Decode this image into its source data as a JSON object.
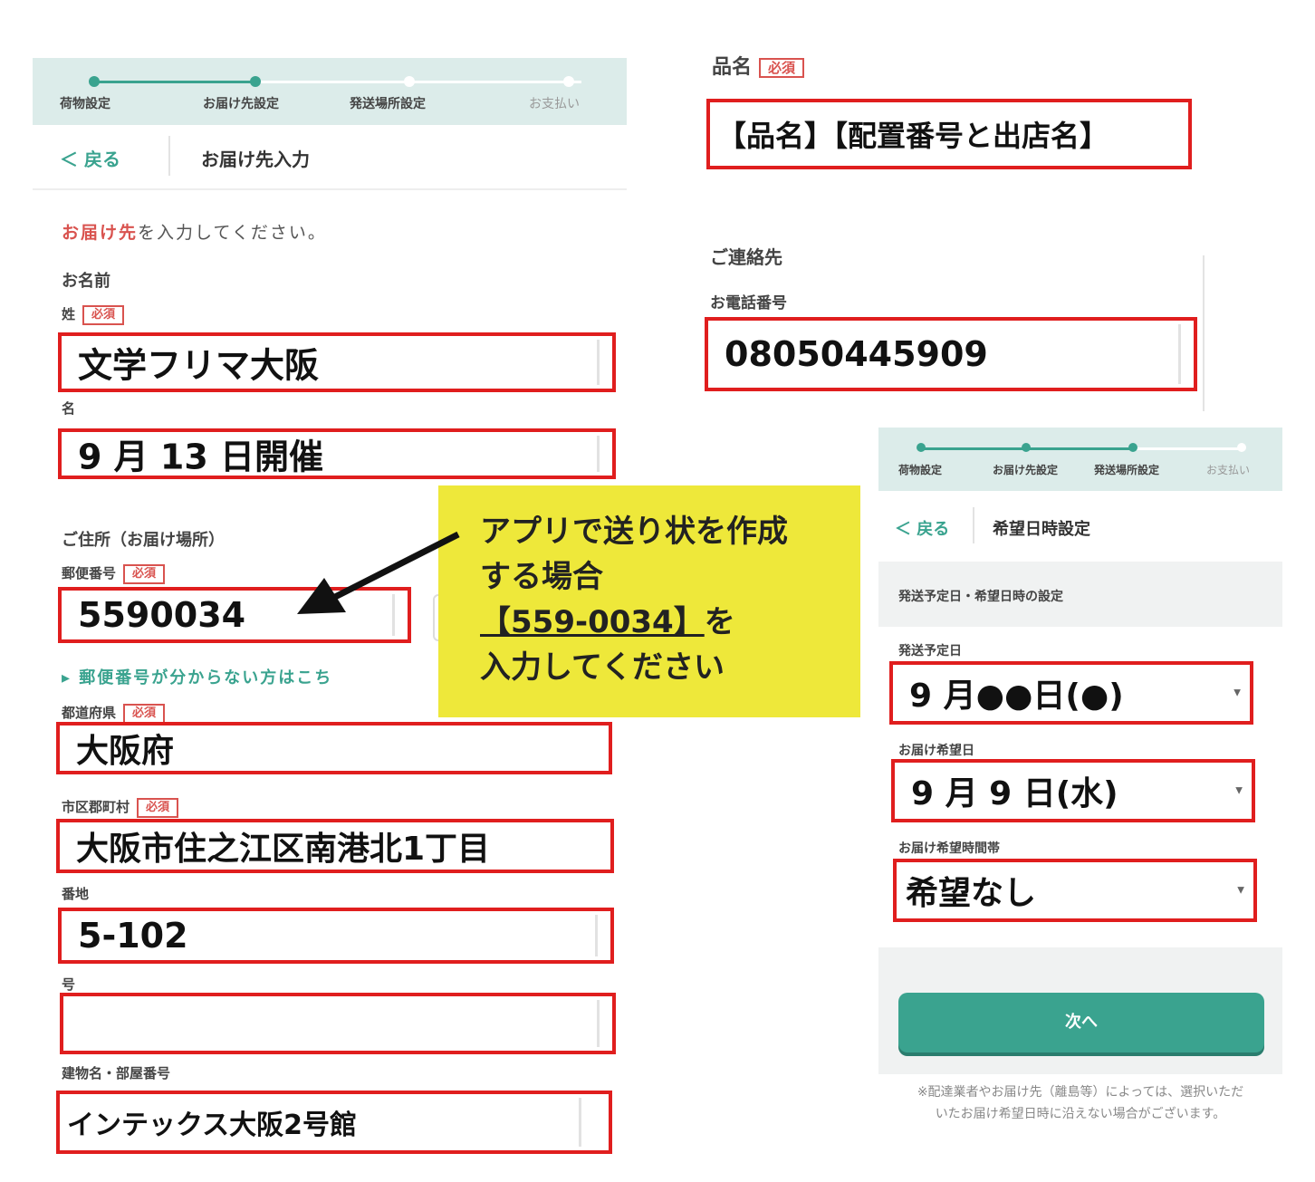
{
  "left_form": {
    "stepper": [
      "荷物設定",
      "お届け先設定",
      "発送場所設定",
      "お支払い"
    ],
    "back_label": "＜ 戻る",
    "header_title": "お届け先入力",
    "prompt_highlight": "お届け先",
    "prompt_rest": "を入力してください。",
    "name_section": "お名前",
    "last_name_label": "姓",
    "required_badge": "必須",
    "last_name_value": "文学フリマ大阪",
    "first_name_label": "名",
    "first_name_value": "9 月 13 日開催",
    "address_section": "ご住所（お届け場所）",
    "postal_label": "郵便番号",
    "postal_value": "5590034",
    "postal_help": "▸ 郵便番号が分からない方はこち",
    "prefecture_label": "都道府県",
    "prefecture_value": "大阪府",
    "city_label": "市区郡町村",
    "city_value": "大阪市住之江区南港北1丁目",
    "banchi_label": "番地",
    "banchi_value": "5-102",
    "go_label": "号",
    "go_value": "",
    "building_label": "建物名・部屋番号",
    "building_value": "インテックス大阪2号館"
  },
  "item_contact": {
    "item_label": "品名",
    "required_badge": "必須",
    "item_value": "【品名】【配置番号と出店名】",
    "contact_section": "ご連絡先",
    "phone_label": "お電話番号",
    "phone_value": "08050445909"
  },
  "callout": {
    "line1": "アプリで送り状を作成",
    "line2": "する場合",
    "line3_underlined": "【559-0034】",
    "line3_rest": "を",
    "line4": "入力してください"
  },
  "schedule_form": {
    "stepper": [
      "荷物設定",
      "お届け先設定",
      "発送場所設定",
      "お支払い"
    ],
    "back_label": "＜ 戻る",
    "header_title": "希望日時設定",
    "section_title": "発送予定日・希望日時の設定",
    "ship_date_label": "発送予定日",
    "ship_date_value": "9 月●●日(●)",
    "delivery_date_label": "お届け希望日",
    "delivery_date_value": "9 月 9 日(水)",
    "delivery_time_label": "お届け希望時間帯",
    "delivery_time_value": "希望なし",
    "next_button": "次へ",
    "footnote_line1": "※配達業者やお届け先（離島等）によっては、選択いただ",
    "footnote_line2": "いたお届け希望日時に沿えない場合がございます。"
  },
  "colors": {
    "accent": "#3aa38f",
    "highlight_border": "#e01e1e",
    "callout_bg": "#eee83a",
    "required": "#d9534f"
  }
}
